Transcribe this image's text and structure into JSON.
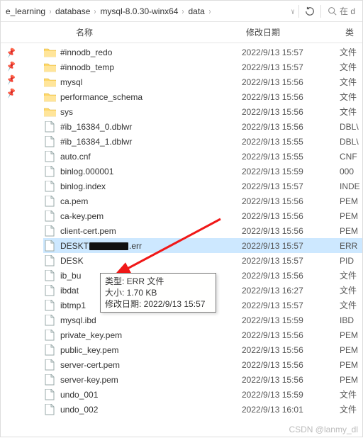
{
  "breadcrumbs": [
    "e_learning",
    "database",
    "mysql-8.0.30-winx64",
    "data"
  ],
  "search_prefix": "在 d",
  "columns": {
    "name": "名称",
    "date": "修改日期",
    "type": "类"
  },
  "tooltip": {
    "line1": "类型: ERR 文件",
    "line2": "大小: 1.70 KB",
    "line3": "修改日期: 2022/9/13 15:57"
  },
  "watermark": "CSDN @lanmy_dl",
  "pins": 4,
  "selected_index": 13,
  "rows": [
    {
      "kind": "folder",
      "name": "#innodb_redo",
      "date": "2022/9/13 15:57",
      "type": "文件"
    },
    {
      "kind": "folder",
      "name": "#innodb_temp",
      "date": "2022/9/13 15:57",
      "type": "文件"
    },
    {
      "kind": "folder",
      "name": "mysql",
      "date": "2022/9/13 15:56",
      "type": "文件"
    },
    {
      "kind": "folder",
      "name": "performance_schema",
      "date": "2022/9/13 15:56",
      "type": "文件"
    },
    {
      "kind": "folder",
      "name": "sys",
      "date": "2022/9/13 15:56",
      "type": "文件"
    },
    {
      "kind": "file",
      "name": "#ib_16384_0.dblwr",
      "date": "2022/9/13 15:56",
      "type": "DBL\\"
    },
    {
      "kind": "file",
      "name": "#ib_16384_1.dblwr",
      "date": "2022/9/13 15:55",
      "type": "DBL\\"
    },
    {
      "kind": "file",
      "name": "auto.cnf",
      "date": "2022/9/13 15:55",
      "type": "CNF"
    },
    {
      "kind": "file",
      "name": "binlog.000001",
      "date": "2022/9/13 15:59",
      "type": "000"
    },
    {
      "kind": "file",
      "name": "binlog.index",
      "date": "2022/9/13 15:57",
      "type": "INDE"
    },
    {
      "kind": "file",
      "name": "ca.pem",
      "date": "2022/9/13 15:56",
      "type": "PEM"
    },
    {
      "kind": "file",
      "name": "ca-key.pem",
      "date": "2022/9/13 15:56",
      "type": "PEM"
    },
    {
      "kind": "file",
      "name": "client-cert.pem",
      "date": "2022/9/13 15:56",
      "type": "PEM"
    },
    {
      "kind": "file",
      "name_parts": [
        "DESKT",
        "REDACT",
        ".err"
      ],
      "date": "2022/9/13 15:57",
      "type": "ERR"
    },
    {
      "kind": "file",
      "name_parts": [
        "DESK"
      ],
      "date": "2022/9/13 15:57",
      "type": "PID"
    },
    {
      "kind": "file",
      "name_parts": [
        "ib_bu"
      ],
      "date": "2022/9/13 15:56",
      "type": "文件"
    },
    {
      "kind": "file",
      "name_parts": [
        "ibdat"
      ],
      "date": "2022/9/13 16:27",
      "type": "文件"
    },
    {
      "kind": "file",
      "name": "ibtmp1",
      "date": "2022/9/13 15:57",
      "type": "文件"
    },
    {
      "kind": "file",
      "name": "mysql.ibd",
      "date": "2022/9/13 15:59",
      "type": "IBD"
    },
    {
      "kind": "file",
      "name": "private_key.pem",
      "date": "2022/9/13 15:56",
      "type": "PEM"
    },
    {
      "kind": "file",
      "name": "public_key.pem",
      "date": "2022/9/13 15:56",
      "type": "PEM"
    },
    {
      "kind": "file",
      "name": "server-cert.pem",
      "date": "2022/9/13 15:56",
      "type": "PEM"
    },
    {
      "kind": "file",
      "name": "server-key.pem",
      "date": "2022/9/13 15:56",
      "type": "PEM"
    },
    {
      "kind": "file",
      "name": "undo_001",
      "date": "2022/9/13 15:59",
      "type": "文件"
    },
    {
      "kind": "file",
      "name": "undo_002",
      "date": "2022/9/13 16:01",
      "type": "文件"
    }
  ]
}
